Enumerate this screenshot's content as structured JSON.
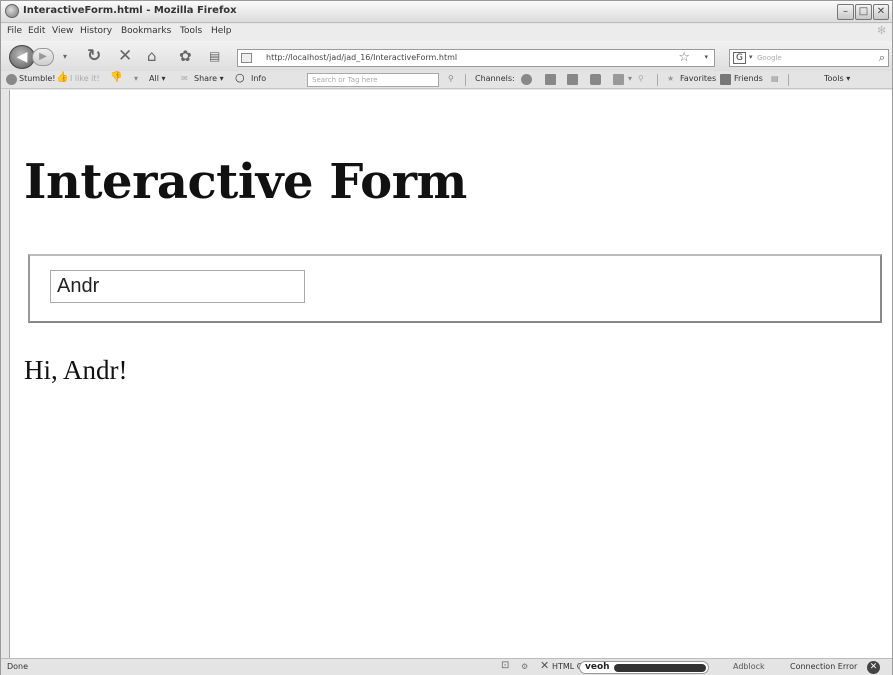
{
  "window": {
    "title": "InteractiveForm.html - Mozilla Firefox"
  },
  "menu": [
    "File",
    "Edit",
    "View",
    "History",
    "Bookmarks",
    "Tools",
    "Help"
  ],
  "nav": {
    "url": "http://localhost/jad/jad_16/InteractiveForm.html",
    "search_placeholder": "Google"
  },
  "stumble": {
    "stumble": "Stumble!",
    "ilike": "I like it!",
    "all": "All ▾",
    "share": "Share ▾",
    "info": "Info",
    "search_placeholder": "Search or Tag here",
    "channels": "Channels:",
    "favorites": "Favorites",
    "friends": "Friends",
    "tools": "Tools ▾"
  },
  "page": {
    "heading": "Interactive Form",
    "input_value": "Andr",
    "greeting": "Hi, Andr!"
  },
  "status": {
    "left": "Done",
    "cache": "HTML Cache is empty",
    "veoh": "veoh",
    "adblock": "Adblock",
    "connection": "Connection Error"
  }
}
